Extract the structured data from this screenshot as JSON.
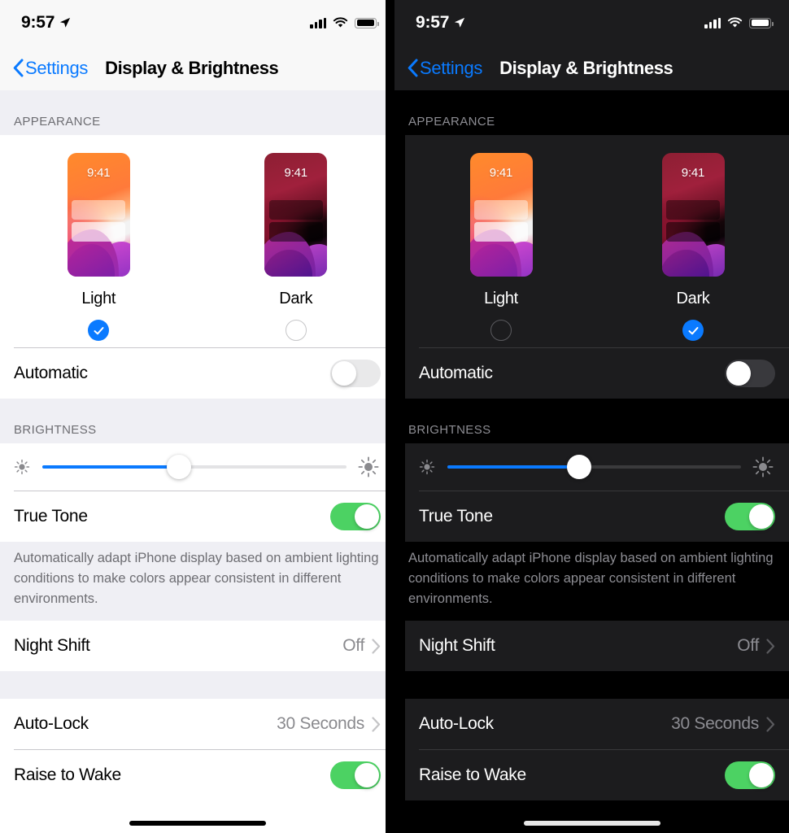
{
  "panels": [
    {
      "mode": "light",
      "status_bar": {
        "time": "9:57",
        "location_icon": "location-arrow-icon",
        "signal_icon": "cellular-signal-icon",
        "wifi_icon": "wifi-icon",
        "battery_icon": "battery-full-icon"
      },
      "nav": {
        "back_icon": "chevron-left-icon",
        "back_label": "Settings",
        "title": "Display & Brightness"
      },
      "appearance": {
        "header": "APPEARANCE",
        "options": [
          {
            "label": "Light",
            "clock": "9:41",
            "selected": true
          },
          {
            "label": "Dark",
            "clock": "9:41",
            "selected": false
          }
        ],
        "automatic": {
          "label": "Automatic",
          "on": false
        }
      },
      "brightness": {
        "header": "BRIGHTNESS",
        "slider": {
          "value": 45,
          "min_icon": "sun-low-icon",
          "max_icon": "sun-high-icon"
        },
        "true_tone": {
          "label": "True Tone",
          "on": true
        },
        "footnote": "Automatically adapt iPhone display based on ambient lighting conditions to make colors appear consistent in different environments."
      },
      "night_shift": {
        "label": "Night Shift",
        "value": "Off",
        "chevron": "chevron-right-icon"
      },
      "auto_lock": {
        "label": "Auto-Lock",
        "value": "30 Seconds",
        "chevron": "chevron-right-icon"
      },
      "raise_to_wake": {
        "label": "Raise to Wake",
        "on": true
      }
    },
    {
      "mode": "dark",
      "status_bar": {
        "time": "9:57",
        "location_icon": "location-arrow-icon",
        "signal_icon": "cellular-signal-icon",
        "wifi_icon": "wifi-icon",
        "battery_icon": "battery-full-icon"
      },
      "nav": {
        "back_icon": "chevron-left-icon",
        "back_label": "Settings",
        "title": "Display & Brightness"
      },
      "appearance": {
        "header": "APPEARANCE",
        "options": [
          {
            "label": "Light",
            "clock": "9:41",
            "selected": false
          },
          {
            "label": "Dark",
            "clock": "9:41",
            "selected": true
          }
        ],
        "automatic": {
          "label": "Automatic",
          "on": false
        }
      },
      "brightness": {
        "header": "BRIGHTNESS",
        "slider": {
          "value": 45,
          "min_icon": "sun-low-icon",
          "max_icon": "sun-high-icon"
        },
        "true_tone": {
          "label": "True Tone",
          "on": true
        },
        "footnote": "Automatically adapt iPhone display based on ambient lighting conditions to make colors appear consistent in different environments."
      },
      "night_shift": {
        "label": "Night Shift",
        "value": "Off",
        "chevron": "chevron-right-icon"
      },
      "auto_lock": {
        "label": "Auto-Lock",
        "value": "30 Seconds",
        "chevron": "chevron-right-icon"
      },
      "raise_to_wake": {
        "label": "Raise to Wake",
        "on": true
      }
    }
  ],
  "colors": {
    "accent_blue": "#0a7aff",
    "toggle_green": "#4cd263",
    "light_bg": "#efeff4",
    "dark_card": "#1c1c1e"
  }
}
